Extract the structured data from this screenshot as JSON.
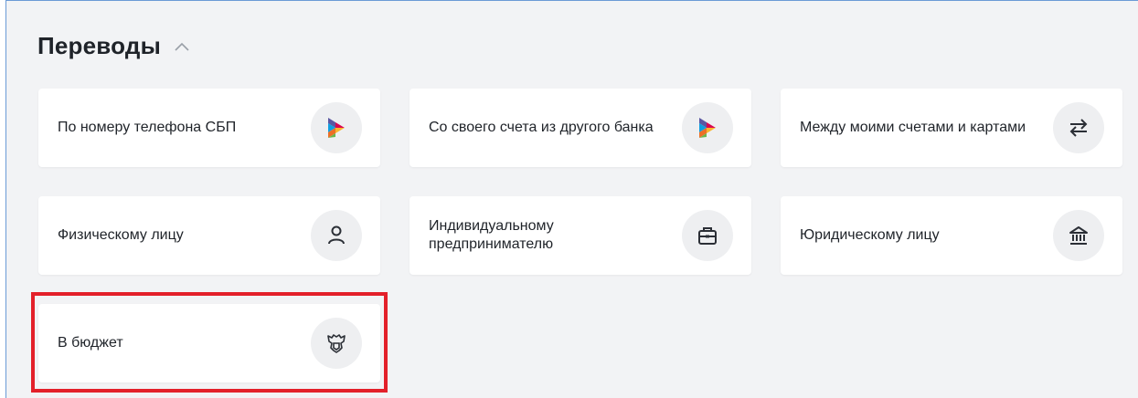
{
  "section": {
    "title": "Переводы",
    "collapse_icon": "chevron-up-icon"
  },
  "cards": [
    {
      "label": "По номеру телефона СБП",
      "icon": "sbp-logo-icon"
    },
    {
      "label": "Со своего счета из другого банка",
      "icon": "sbp-logo-icon"
    },
    {
      "label": "Между моими счетами и картами",
      "icon": "transfer-arrows-icon"
    },
    {
      "label": "Физическому лицу",
      "icon": "person-icon"
    },
    {
      "label": "Индивидуальному предпринимателю",
      "icon": "briefcase-icon"
    },
    {
      "label": "Юридическому лицу",
      "icon": "bank-building-icon"
    },
    {
      "label": "В бюджет",
      "icon": "coat-of-arms-icon"
    }
  ],
  "highlighted_card": "В бюджет",
  "colors": {
    "background": "#f2f3f5",
    "card": "#ffffff",
    "icon_circle": "#eeeff1",
    "highlight": "#e3202a",
    "text": "#1f2329"
  }
}
